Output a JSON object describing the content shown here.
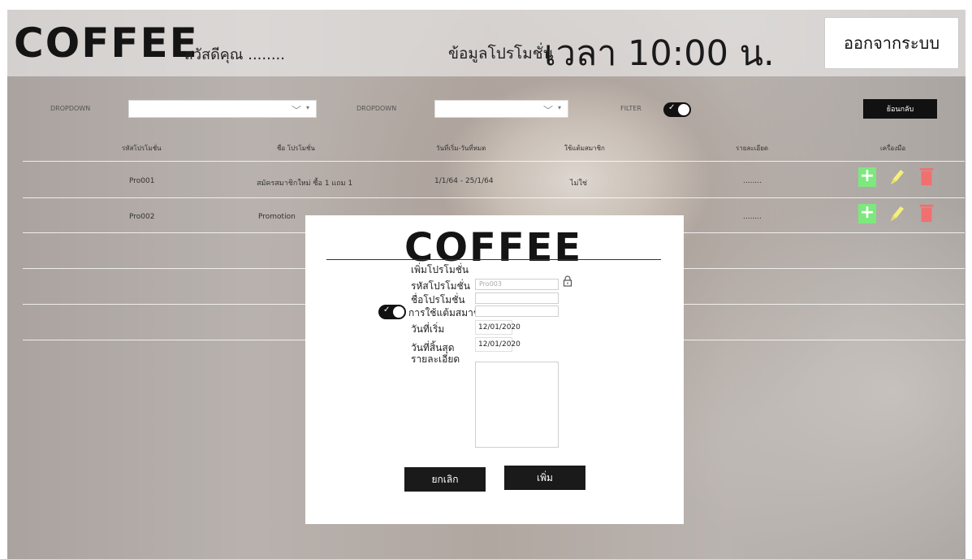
{
  "header": {
    "logo": "COFFEE",
    "greeting": "สวัสดีคุณ ........",
    "page_heading": "ข้อมูลโปรโมชั่น",
    "time": "เวลา 10:00 น.",
    "logout_label": "ออกจากระบบ"
  },
  "filters": {
    "dropdown1_label": "DROPDOWN",
    "dropdown2_label": "DROPDOWN",
    "filter_label": "FILTER",
    "back_label": "ย้อนกลับ"
  },
  "table": {
    "columns": [
      "รหัสโปรโมชั่น",
      "ชื่อ โปรโมชั่น",
      "วันที่เริ่ม-วันที่หมด",
      "ใช้แต้มสมาชิก",
      "รายละเอียด",
      "เครื่องมือ"
    ],
    "rows": [
      {
        "id": "Pro001",
        "name": "สมัครสมาชิกใหม่ ซื้อ 1 แถม 1",
        "dates": "1/1/64 - 25/1/64",
        "use_points": "ไม่ใช่",
        "detail": "........"
      },
      {
        "id": "Pro002",
        "name": "Promotion",
        "dates": "",
        "use_points": "",
        "detail": "........"
      }
    ]
  },
  "modal": {
    "logo": "COFFEE",
    "title": "เพิ่มโปรโมชั่น",
    "id_label": "รหัสโปรโมชั่น",
    "id_value": "Pro003",
    "name_label": "ชื่อโปรโมชั่น",
    "points_label": "การใช้แต้มสมาชิก",
    "start_label": "วันที่เริ่ม",
    "start_value": "12/01/2020",
    "end_label": "วันที่สิ้นสุด",
    "end_value": "12/01/2020",
    "detail_label": "รายละเอียด",
    "cancel_label": "ยกเลิก",
    "add_label": "เพิ่ม"
  },
  "colors": {
    "add_tool": "#7de87d",
    "edit_tool": "#f5f07a",
    "delete_tool": "#f07070",
    "dark": "#111111"
  }
}
